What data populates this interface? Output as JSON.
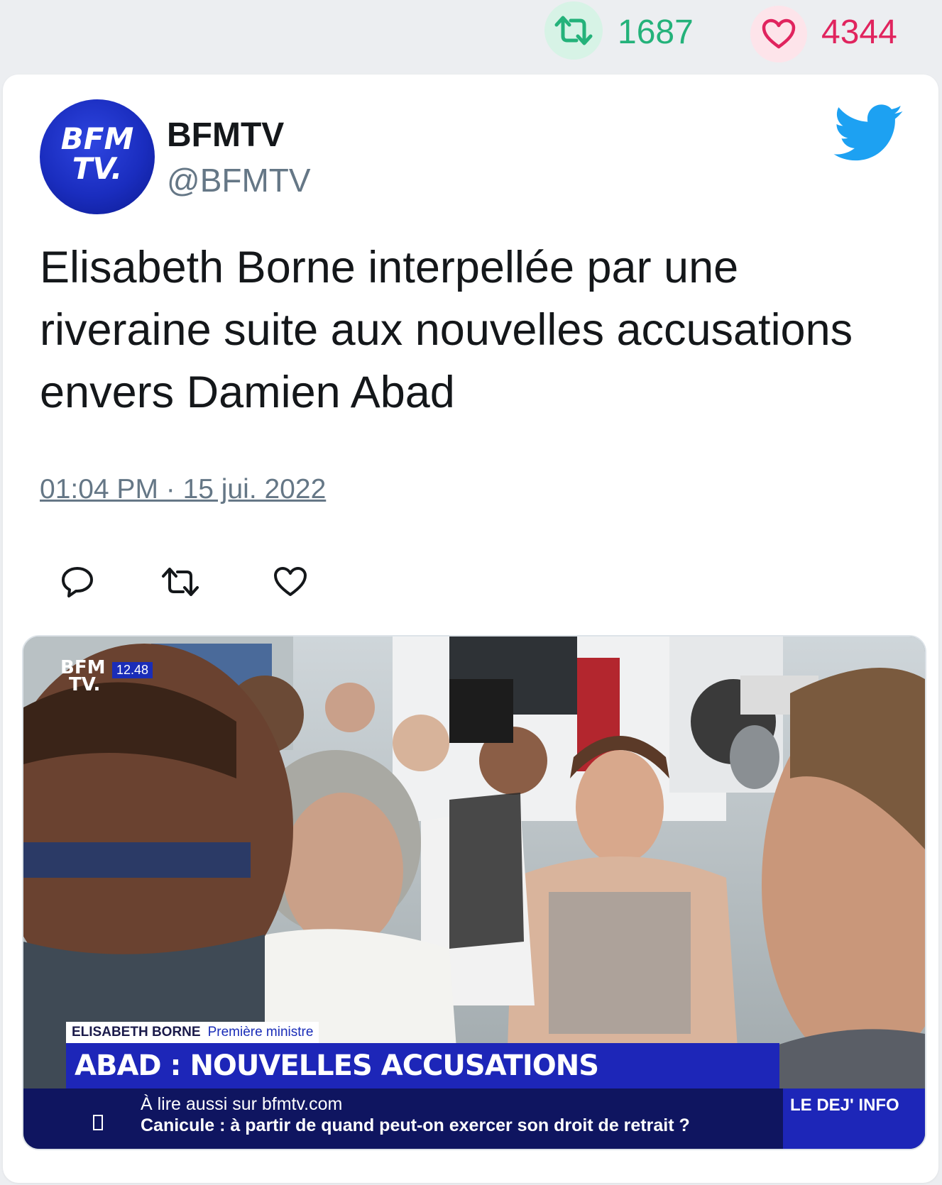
{
  "stats": {
    "retweet_icon": "retweet-icon",
    "retweet_count": "1687",
    "like_icon": "heart-icon",
    "like_count": "4344",
    "retweet_color": "#24b27a",
    "like_color": "#e0245e"
  },
  "tweet": {
    "author": {
      "name": "BFMTV",
      "handle": "@BFMTV",
      "avatar_text_line1": "BFM",
      "avatar_text_line2": "TV."
    },
    "platform_icon": "twitter-bird-icon",
    "text": "Elisabeth Borne interpellée par une riveraine suite aux nouvelles accusations envers Damien Abad",
    "timestamp": "01:04 PM · 15 jui. 2022",
    "actions": [
      {
        "icon": "reply-icon"
      },
      {
        "icon": "retweet-icon"
      },
      {
        "icon": "heart-icon"
      }
    ]
  },
  "media": {
    "channel_logo_line1": "BFM",
    "channel_logo_line2": "TV.",
    "clock": "12.48",
    "lower_third_name": "ELISABETH BORNE",
    "lower_third_title": "Première ministre",
    "headline": "ABAD : NOUVELLES ACCUSATIONS",
    "ticker_line1": "À lire aussi sur bfmtv.com",
    "ticker_line2": "Canicule : à partir de quand peut-on exercer son droit de retrait ?",
    "ticker_right": "LE DEJ' INFO"
  },
  "colors": {
    "brand_blue": "#1d26b8",
    "twitter_blue": "#1da1f2",
    "text_primary": "#14171a",
    "text_secondary": "#657786"
  }
}
